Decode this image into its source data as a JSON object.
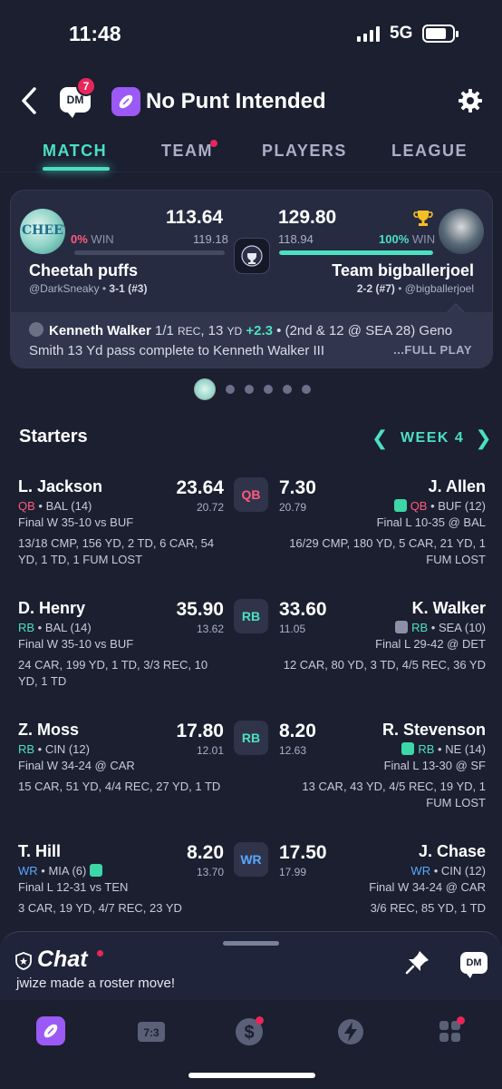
{
  "status": {
    "time": "11:48",
    "network": "5G"
  },
  "header": {
    "dm_label": "DM",
    "dm_badge": "7",
    "league_name": "No Punt Intended"
  },
  "tabs": [
    {
      "label": "MATCH"
    },
    {
      "label": "TEAM"
    },
    {
      "label": "PLAYERS"
    },
    {
      "label": "LEAGUE"
    }
  ],
  "matchup": {
    "left": {
      "avatar_text": "CHEETAH",
      "score": "113.64",
      "projected": "119.18",
      "win_pct": "0%",
      "win_label": "WIN",
      "win_fraction": 0.0,
      "team": "Cheetah puffs",
      "handle": "@DarkSneaky",
      "record": "3-1 (#3)"
    },
    "right": {
      "score": "129.80",
      "projected": "118.94",
      "win_pct": "100%",
      "win_label": "WIN",
      "win_fraction": 1.0,
      "team": "Team bigballerjoel",
      "handle": "@bigballerjoel",
      "record": "2-2 (#7)"
    },
    "play": {
      "player": "Kenneth Walker",
      "stat_pre": " 1/1 ",
      "rec": "REC",
      "stat_mid": ", 13 ",
      "yd": "YD",
      "gain": "+2.3",
      "text": " • (2nd & 12 @ SEA 28) Geno Smith 13 Yd pass complete to Kenneth Walker III",
      "full_play": "...FULL PLAY"
    }
  },
  "section": {
    "title": "Starters",
    "week": "WEEK 4"
  },
  "starters": [
    {
      "pos": "QB",
      "pos_class": "qb",
      "left": {
        "name": "L. Jackson",
        "pos": "QB",
        "team": " • BAL (14)",
        "game": "Final W 35-10 vs BUF",
        "stats": "13/18 CMP, 156 YD, 2 TD, 6 CAR, 54 YD, 1 TD, 1 FUM LOST",
        "pts": "23.64",
        "proj": "20.72"
      },
      "right": {
        "name": "J. Allen",
        "pos": "QB",
        "team": " • BUF (12)",
        "game": "Final L 10-35 @ BAL",
        "stats": "16/29 CMP, 180 YD, 5 CAR, 21 YD, 1 FUM LOST",
        "pts": "7.30",
        "proj": "20.79"
      }
    },
    {
      "pos": "RB",
      "pos_class": "rb",
      "left": {
        "name": "D. Henry",
        "pos": "RB",
        "team": " • BAL (14)",
        "game": "Final W 35-10 vs BUF",
        "stats": "24 CAR, 199 YD, 1 TD, 3/3 REC, 10 YD, 1 TD",
        "pts": "35.90",
        "proj": "13.62"
      },
      "right": {
        "name": "K. Walker",
        "pos": "RB",
        "team": " • SEA (10)",
        "game": "Final L 29-42 @ DET",
        "stats": "12 CAR, 80 YD, 3 TD, 4/5 REC, 36 YD",
        "pts": "33.60",
        "proj": "11.05"
      }
    },
    {
      "pos": "RB",
      "pos_class": "rb",
      "left": {
        "name": "Z. Moss",
        "pos": "RB",
        "team": " • CIN (12)",
        "game": "Final W 34-24 @ CAR",
        "stats": "15 CAR, 51 YD, 4/4 REC, 27 YD, 1 TD",
        "pts": "17.80",
        "proj": "12.01"
      },
      "right": {
        "name": "R. Stevenson",
        "pos": "RB",
        "team": " • NE (14)",
        "game": "Final L 13-30 @ SF",
        "stats": "13 CAR, 43 YD, 4/5 REC, 19 YD, 1 FUM LOST",
        "pts": "8.20",
        "proj": "12.63"
      }
    },
    {
      "pos": "WR",
      "pos_class": "wr",
      "left": {
        "name": "T. Hill",
        "pos": "WR",
        "team": " • MIA (6)",
        "game": "Final L 12-31 vs TEN",
        "stats": "3 CAR, 19 YD, 4/7 REC, 23 YD",
        "pts": "8.20",
        "proj": "13.70"
      },
      "right": {
        "name": "J. Chase",
        "pos": "WR",
        "team": " • CIN (12)",
        "game": "Final W 34-24 @ CAR",
        "stats": "3/6 REC, 85 YD, 1 TD",
        "pts": "17.50",
        "proj": "17.99"
      }
    }
  ],
  "chat": {
    "title": "Chat",
    "message": "jwize made a roster move!",
    "dm_label": "DM"
  },
  "nav": {
    "scores_label": "7:3"
  },
  "colors": {
    "accent": "#4be0c1",
    "alert": "#e8265a",
    "qb": "#ff5b7e",
    "rb": "#4be0c1",
    "wr": "#5aa7ff",
    "league": "#9b59f5"
  }
}
